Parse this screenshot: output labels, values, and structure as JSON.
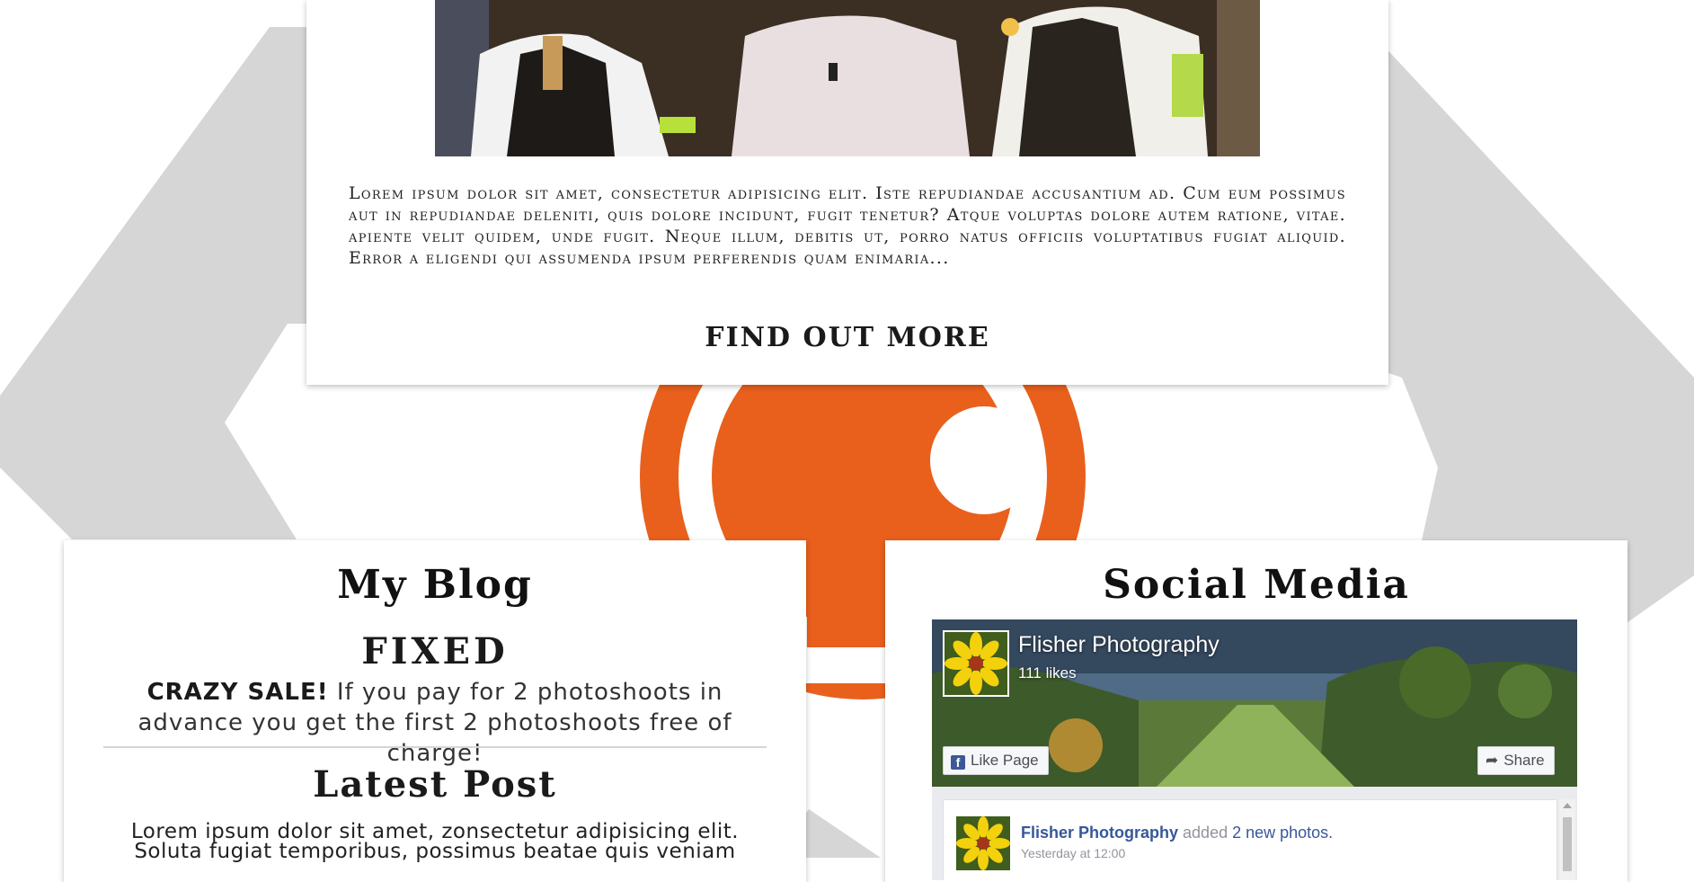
{
  "top_article": {
    "photo_alt": "three men standing",
    "excerpt": "Lorem ipsum dolor sit amet, consectetur adipisicing elit. Iste repudiandae accusantium ad. Cum eum possimus aut in repudiandae deleniti, quis dolore incidunt, fugit tenetur? Atque voluptas dolore autem ratione, vitae. apiente velit quidem, unde fugit. Neque illum, debitis ut, porro natus officiis voluptatibus fugiat aliquid. Error a eligendi qui assumenda ipsum perferendis quam enimaria...",
    "find_more_label": "FIND OUT MORE"
  },
  "blog": {
    "title": "My Blog",
    "fixed_label": "FIXED",
    "announce_bold": "CRAZY SALE!",
    "announce_text": " If you pay for 2 photoshoots in advance you get the first 2 photoshoots free of charge!",
    "latest_title": "Latest Post",
    "latest_text": "Lorem ipsum dolor sit amet, zonsectetur adipisicing elit. Soluta fugiat temporibus, possimus beatae quis veniam"
  },
  "social": {
    "title": "Social Media",
    "page_name": "Flisher Photography",
    "likes": "111 likes",
    "like_button": "Like Page",
    "share_button": "Share",
    "post_author": "Flisher Photography",
    "post_action": " added ",
    "post_link": "2 new photos.",
    "post_time": "Yesterday at 12:00"
  },
  "colors": {
    "accent_orange": "#e8601c",
    "background_gray": "#d6d6d6",
    "facebook_blue": "#365899"
  },
  "icons": [
    "camera-logo-icon",
    "facebook-f-icon",
    "share-arrow-icon",
    "flower-avatar-icon"
  ]
}
